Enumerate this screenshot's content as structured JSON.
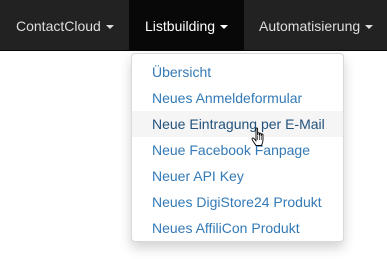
{
  "navbar": {
    "items": [
      {
        "label": "ContactCloud"
      },
      {
        "label": "Listbuilding"
      },
      {
        "label": "Automatisierung"
      }
    ]
  },
  "dropdown": {
    "items": [
      {
        "label": "Übersicht"
      },
      {
        "label": "Neues Anmeldeformular"
      },
      {
        "label": "Neue Eintragung per E-Mail"
      },
      {
        "label": "Neue Facebook Fanpage"
      },
      {
        "label": "Neuer API Key"
      },
      {
        "label": "Neues DigiStore24 Produkt"
      },
      {
        "label": "Neues AffiliCon Produkt"
      }
    ]
  },
  "colors": {
    "navbar_bg": "#222222",
    "navbar_active_bg": "#080808",
    "link": "#337ab7",
    "hover_bg": "#f5f5f5"
  }
}
